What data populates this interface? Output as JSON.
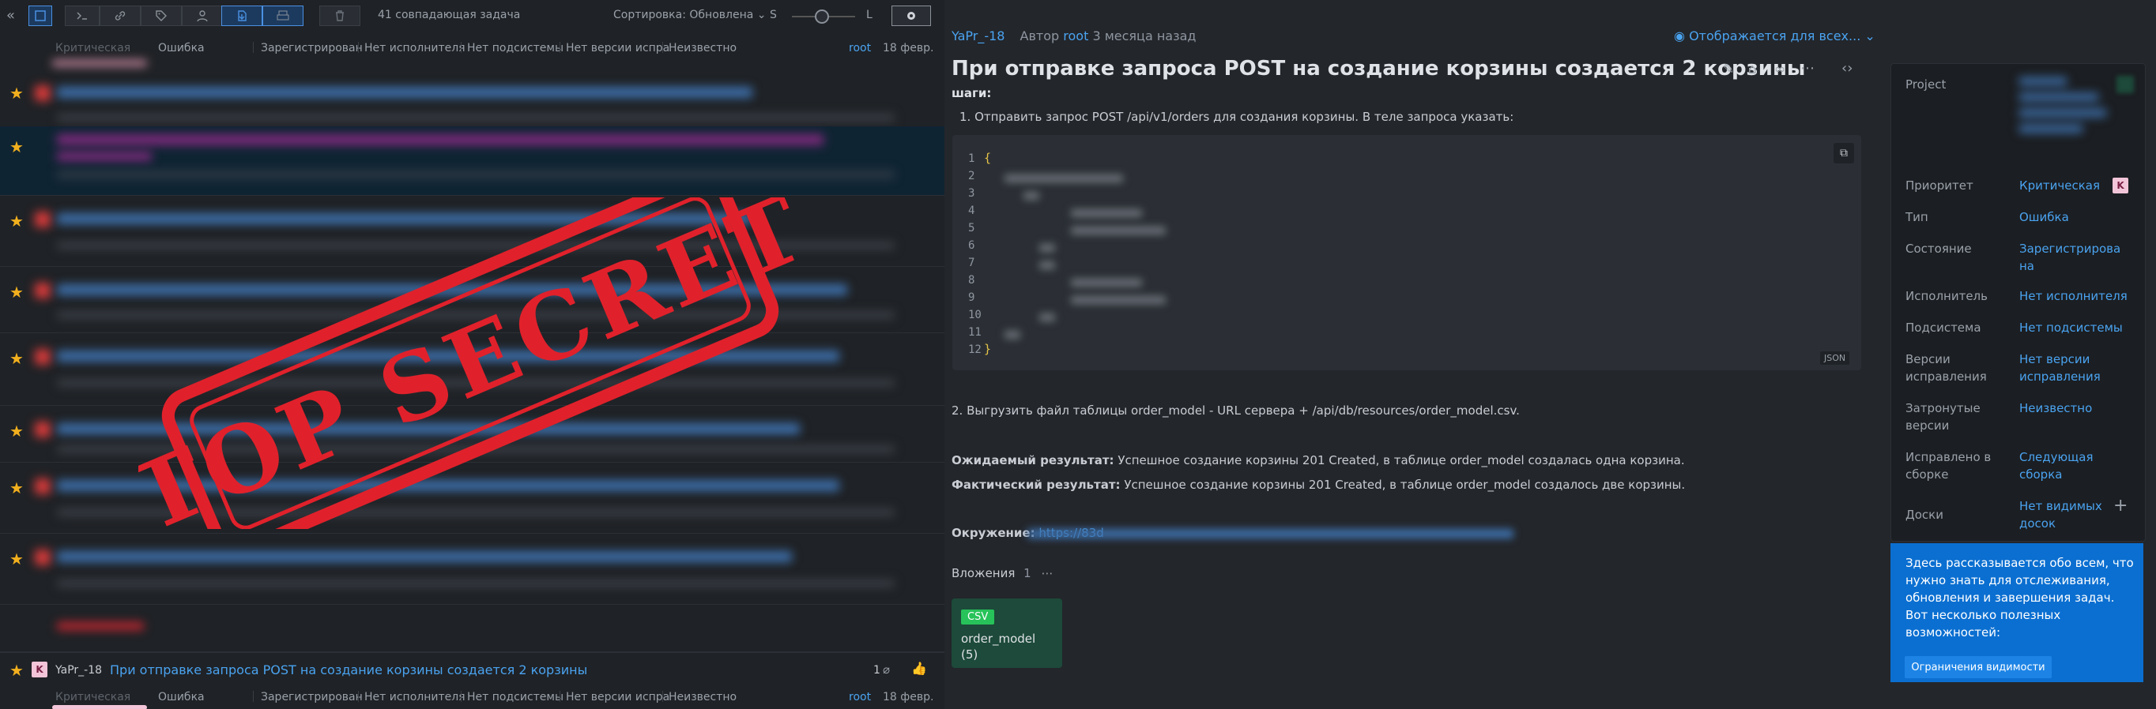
{
  "toolbar": {
    "count_label": "41 совпадающая задача",
    "sort_label": "Сортировка: Обновлена",
    "size_small": "S",
    "size_large": "L"
  },
  "list_header_meta": {
    "priority": "Критическая",
    "type": "Ошибка",
    "state": "Зарегистрирован",
    "assignee": "Нет исполнителя",
    "subsystem": "Нет подсистемы",
    "fix_version": "Нет версии испра",
    "affected": "Неизвестно",
    "author": "root",
    "date": "18 февр."
  },
  "bottom_item": {
    "avatar_letter": "K",
    "issue_id": "YaPr_-18",
    "title": "При отправке запроса POST на создание корзины создается 2 корзины",
    "attachments": "1",
    "priority": "Критическая",
    "type": "Ошибка",
    "state": "Зарегистрирован",
    "assignee": "Нет исполнителя",
    "subsystem": "Нет подсистемы",
    "fix_version": "Нет версии испра",
    "affected": "Неизвестно",
    "author": "root",
    "date": "18 февр."
  },
  "stamp": {
    "text": "TOP SECRET"
  },
  "issue": {
    "id": "YaPr_-18",
    "author_prefix": "Автор",
    "author": "root",
    "time_ago": "3 месяца назад",
    "visibility": "Отображается для всех...",
    "votes": "1",
    "title": "При отправке запроса POST на создание корзины создается 2 корзины",
    "steps_heading": "шаги:",
    "step1": "1. Отправить запрос POST /api/v1/orders для создания корзины. В теле запроса указать:",
    "code_lines": [
      "1",
      "2",
      "3",
      "4",
      "5",
      "6",
      "7",
      "8",
      "9",
      "10",
      "11",
      "12"
    ],
    "code_open": "{",
    "code_close": "}",
    "code_lang": "JSON",
    "step2": "2. Выгрузить файл таблицы order_model - URL сервера + /api/db/resources/order_model.csv.",
    "expected_label": "Ожидаемый результат:",
    "expected_text": " Успешное создание корзины 201 Created, в таблице order_model создалась одна корзина.",
    "actual_label": "Фактический результат:",
    "actual_text": " Успешное создание корзины 201 Created, в таблице order_model создалось две корзины.",
    "env_label": "Окружение:",
    "env_link": "https://83d",
    "attachments_label": "Вложения",
    "attachments_count": "1",
    "attachment_badge": "CSV",
    "attachment_name": "order_model",
    "attachment_suffix": "(5)"
  },
  "fields": [
    {
      "label": "Project",
      "value": ""
    },
    {
      "label": "Приоритет",
      "value": "Критическая",
      "badge": "K"
    },
    {
      "label": "Тип",
      "value": "Ошибка"
    },
    {
      "label": "Состояние",
      "value": "Зарегистрирова на"
    },
    {
      "label": "Исполнитель",
      "value": "Нет исполнителя"
    },
    {
      "label": "Подсистема",
      "value": "Нет подсистемы"
    },
    {
      "label": "Версии исправления",
      "value": "Нет версии исправления"
    },
    {
      "label": "Затронутые версии",
      "value": "Неизвестно"
    },
    {
      "label": "Исправлено в сборке",
      "value": "Следующая сборка"
    },
    {
      "label": "Доски",
      "value": "Нет видимых досок"
    }
  ],
  "help": {
    "text": "Здесь рассказывается обо всем, что нужно знать для отслеживания, обновления и завершения задач. Вот несколько полезных возможностей:",
    "button": "Ограничения видимости"
  },
  "colors": {
    "accent": "#4aa3f0",
    "star": "#f2b01e",
    "stamp_red": "#e0212b",
    "help_bg": "#0b6fd1"
  }
}
